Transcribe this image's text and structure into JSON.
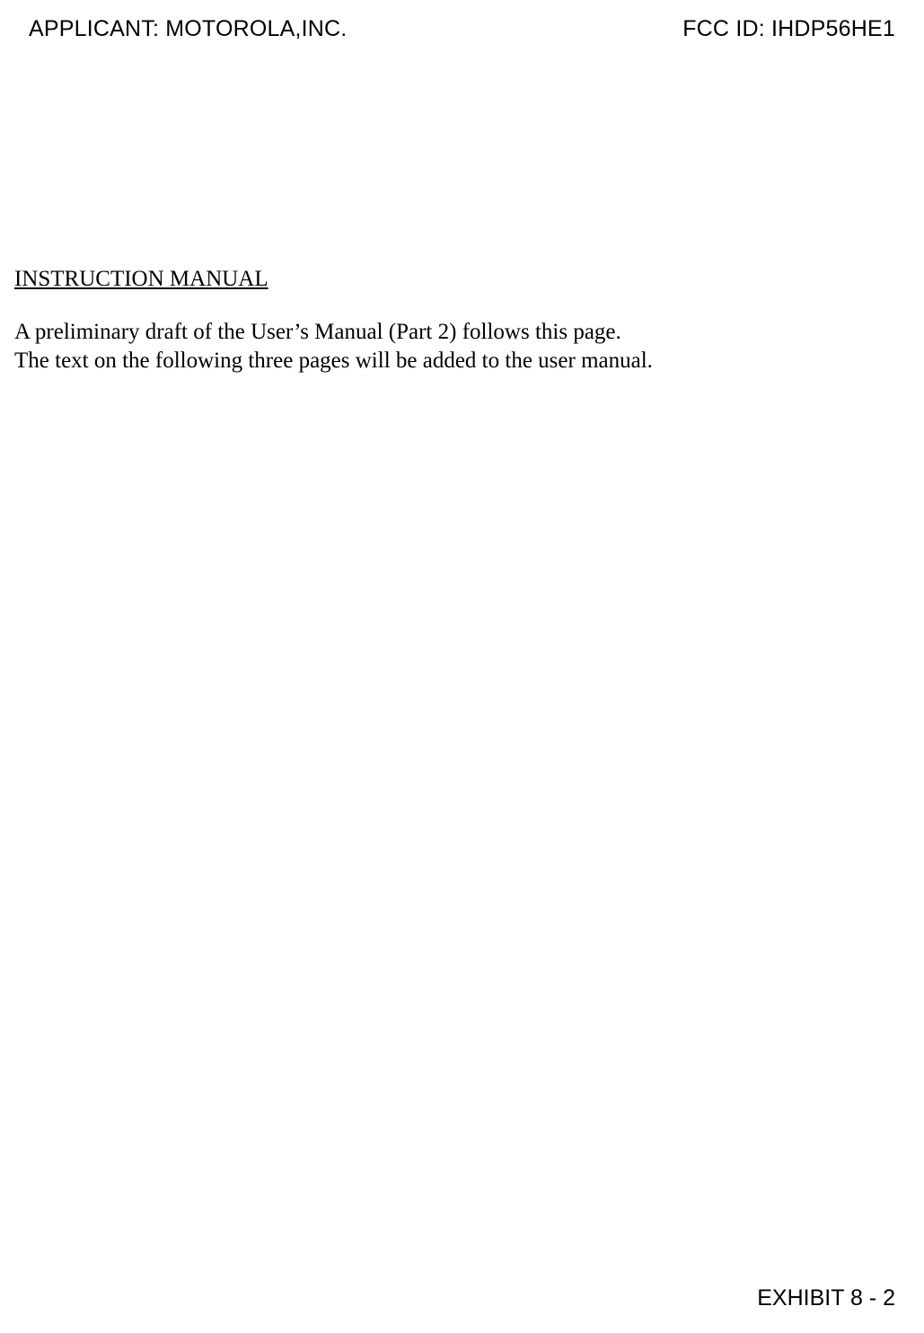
{
  "header": {
    "applicant_label": "APPLICANT: MOTOROLA,INC.",
    "fcc_id_label": "FCC ID: IHDP56HE1"
  },
  "content": {
    "section_title": "INSTRUCTION MANUAL",
    "paragraph1": "A preliminary draft of the User’s Manual (Part 2) follows this page.",
    "paragraph2": "The text on the following three pages will be added to the user manual."
  },
  "footer": {
    "exhibit_label": "EXHIBIT 8 - 2"
  }
}
